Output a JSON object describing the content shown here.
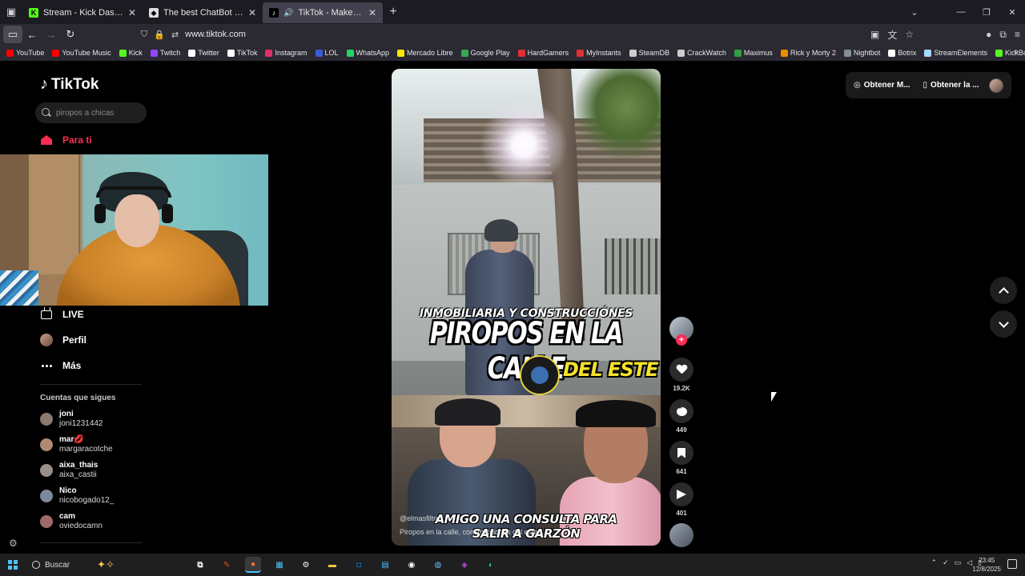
{
  "browser": {
    "tabs": [
      {
        "title": "Stream - Kick Dashboard",
        "active": false,
        "favicon_color": "#53fc18"
      },
      {
        "title": "The best ChatBot and Widgets",
        "active": false,
        "favicon_color": "#dcdcdc"
      },
      {
        "title": "TikTok - Make Your Day",
        "active": true,
        "favicon_color": "#000000"
      }
    ],
    "url": "www.tiktok.com",
    "bookmarks": [
      {
        "label": "YouTube",
        "color": "#ff0000"
      },
      {
        "label": "YouTube Music",
        "color": "#ff0000"
      },
      {
        "label": "Kick",
        "color": "#53fc18"
      },
      {
        "label": "Twitch",
        "color": "#9146ff"
      },
      {
        "label": "Twitter",
        "color": "#ffffff"
      },
      {
        "label": "TikTok",
        "color": "#ffffff"
      },
      {
        "label": "Instagram",
        "color": "#e1306c"
      },
      {
        "label": "LOL",
        "color": "#3b5bdb"
      },
      {
        "label": "WhatsApp",
        "color": "#25d366"
      },
      {
        "label": "Mercado Libre",
        "color": "#ffe600"
      },
      {
        "label": "Google Play",
        "color": "#34a853"
      },
      {
        "label": "HardGamers",
        "color": "#e03131"
      },
      {
        "label": "MyInstants",
        "color": "#e03131"
      },
      {
        "label": "SteamDB",
        "color": "#cccccc"
      },
      {
        "label": "CrackWatch",
        "color": "#cccccc"
      },
      {
        "label": "Maximus",
        "color": "#2f9e44"
      },
      {
        "label": "Rick y Morty 2",
        "color": "#f08c00"
      },
      {
        "label": "Nightbot",
        "color": "#868e96"
      },
      {
        "label": "Botrix",
        "color": "#ffffff"
      },
      {
        "label": "StreamElements",
        "color": "#a5d8ff"
      },
      {
        "label": "KickBot",
        "color": "#53fc18"
      }
    ]
  },
  "tiktok": {
    "logo_text": "TikTok",
    "search_placeholder": "piropos a chicas",
    "nav": {
      "for_you": "Para ti",
      "live": "LIVE",
      "profile": "Perfil",
      "more": "Más"
    },
    "following_title": "Cuentas que sigues",
    "following": [
      {
        "name": "joni",
        "handle": "joni1231442",
        "color": "#8a7a70"
      },
      {
        "name": "mar💋",
        "handle": "margaracotche",
        "color": "#b08a70"
      },
      {
        "name": "aixa_thais",
        "handle": "aixa_castii",
        "color": "#9a8f88"
      },
      {
        "name": "Nico",
        "handle": "nicobogado12_",
        "color": "#7a8a9a"
      },
      {
        "name": "cam",
        "handle": "oviedocamn",
        "color": "#a06a6a"
      }
    ],
    "top_buttons": {
      "coins": "Obtener M...",
      "app": "Obtener la ..."
    },
    "video": {
      "overlay_line1": "INMOBILIARIA Y CONSTRUCCIÓNES",
      "overlay_line2": "PIROPOS EN LA CALLE",
      "overlay_line3": "DEL ESTE",
      "overlay_bottom_1": "AMIGO UNA CONSULTA PARA",
      "overlay_bottom_2": "SALIR A GARZÓN",
      "author": "@elmasfiltro",
      "description": "Piropos en la calle, construcciones del este..."
    },
    "stats": {
      "likes": "19.2K",
      "comments": "449",
      "saves": "641",
      "shares": "401"
    }
  },
  "taskbar": {
    "search_label": "Buscar",
    "time": "23:45",
    "date": "12/8/2025"
  }
}
